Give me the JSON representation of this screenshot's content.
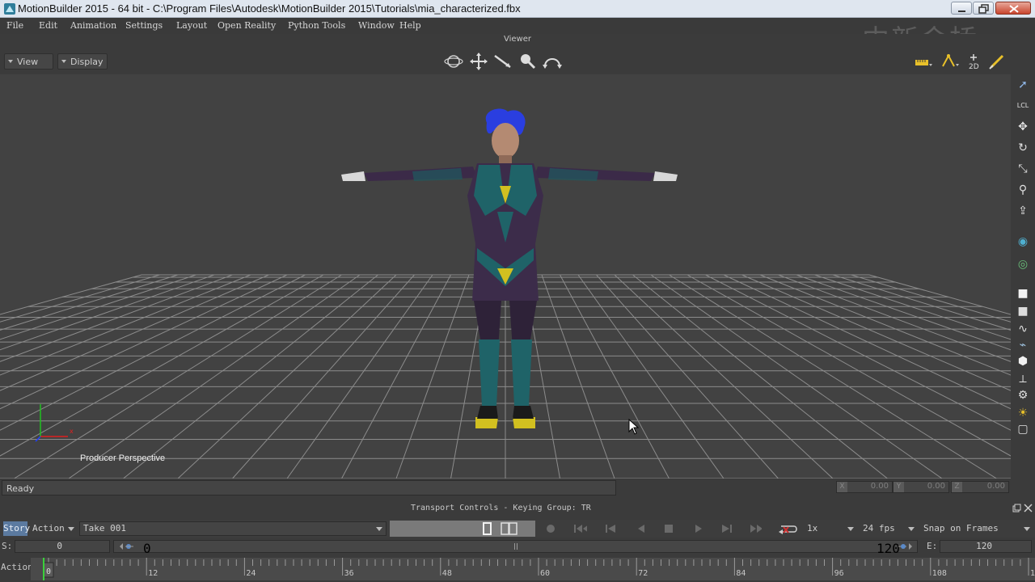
{
  "window": {
    "title": "MotionBuilder 2015  -  64 bit  -  C:\\Program Files\\Autodesk\\MotionBuilder 2015\\Tutorials\\mia_characterized.fbx"
  },
  "menubar": {
    "items": [
      "File",
      "Edit",
      "Animation",
      "Settings",
      "Layout",
      "Open Reality",
      "Python Tools",
      "Window",
      "Help"
    ]
  },
  "watermark": "中新金桥",
  "viewer": {
    "title": "Viewer",
    "view_label": "View",
    "display_label": "Display",
    "camera_label": "Producer Perspective",
    "nav_icons": [
      "orbit-icon",
      "pan-icon",
      "dolly-icon",
      "zoom-icon",
      "undo-view-icon"
    ],
    "right_header_icons": [
      "ruler-icon",
      "curve-icon",
      "2d-icon",
      "brush-icon"
    ],
    "right_header_2d": "2D"
  },
  "right_toolbar": {
    "icons": [
      "select-icon",
      "local-icon",
      "translate-icon",
      "rotate-icon",
      "scale-icon",
      "pivot-icon",
      "export-icon",
      "globe-icon",
      "center-icon",
      "cube-icon",
      "cube2-icon",
      "path-icon",
      "wand-icon",
      "hexagon-icon",
      "skeleton-icon",
      "gear-icon",
      "light-icon",
      "frame-icon"
    ],
    "local_label": "LCL"
  },
  "status": {
    "text": "Ready",
    "coords": [
      {
        "axis": "X",
        "value": "0.00"
      },
      {
        "axis": "Y",
        "value": "0.00"
      },
      {
        "axis": "Z",
        "value": "0.00"
      }
    ]
  },
  "transport": {
    "header": "Transport Controls  -  Keying Group: TR",
    "story_label": "Story",
    "action_label": "Action",
    "take": "Take 001",
    "speed": "1x",
    "fps": "24 fps",
    "snap": "Snap on Frames"
  },
  "range": {
    "start_label": "S:",
    "start_value": "0",
    "slider_start": "0",
    "slider_end": "120",
    "end_label": "E:",
    "end_value": "120"
  },
  "timeline": {
    "label": "Action",
    "current_frame": "0",
    "ticks": [
      "12",
      "24",
      "36",
      "48",
      "60",
      "72",
      "84",
      "96",
      "108",
      "12"
    ],
    "max_frame": 120
  },
  "colors": {
    "viewport_bg": "#424242",
    "grid_line": "#8c8c8c",
    "story_accent": "#5b7aa0",
    "axis_x": "#e02020",
    "axis_y": "#20c020",
    "axis_z": "#2040ff"
  }
}
